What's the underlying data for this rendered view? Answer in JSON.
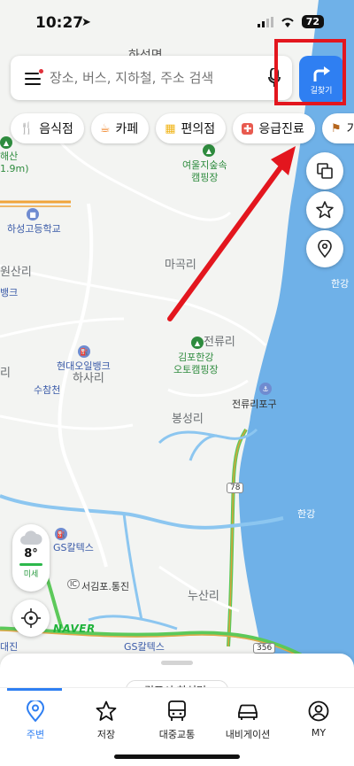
{
  "status_bar": {
    "time": "10:27",
    "battery": "72"
  },
  "search": {
    "placeholder": "장소, 버스, 지하철, 주소 검색"
  },
  "directions": {
    "label": "길찾기"
  },
  "categories": [
    {
      "label": "음식점",
      "icon": "fork-knife-icon"
    },
    {
      "label": "카페",
      "icon": "coffee-icon"
    },
    {
      "label": "편의점",
      "icon": "store-icon"
    },
    {
      "label": "응급진료",
      "icon": "medical-cross-icon"
    },
    {
      "label": "가",
      "icon": "flag-icon"
    }
  ],
  "map": {
    "top_town": "하성면",
    "labels": {
      "haesan": "해산",
      "haesan_dist": "1.9m)",
      "forest_camp": "여울지숲속\n캠핑장",
      "school": "하성고등학교",
      "wonsan": "원산리",
      "bank_left": "뱅크",
      "magok": "마곡리",
      "river_right_1": "한강",
      "jeonryu": "전류리",
      "hyundai_bank": "현대오일뱅크",
      "hasa": "하사리",
      "gimpo_camp": "김포한강\n오토캠핑장",
      "sucham": "수참천",
      "ri_left": "리",
      "bongseong": "봉성리",
      "jeonryu_port": "전류리포구",
      "road_78": "78",
      "river_right_2": "한강",
      "gs_caltex_1": "GS칼텍스",
      "seogimpo": "서김포.통진",
      "nusan": "누산리",
      "gs_caltex_2": "GS칼텍스",
      "daejin": "대진",
      "road_356": "356",
      "ic": "IC"
    }
  },
  "weather": {
    "temp": "8°",
    "dust": "미세"
  },
  "naver_logo": "NAVER",
  "sheet": {
    "chip_text": "김포시 하성면"
  },
  "tabs": [
    {
      "label": "주변",
      "icon": "location-pin-icon",
      "active": true
    },
    {
      "label": "저장",
      "icon": "star-icon",
      "active": false
    },
    {
      "label": "대중교통",
      "icon": "bus-icon",
      "active": false
    },
    {
      "label": "내비게이션",
      "icon": "car-icon",
      "active": false
    },
    {
      "label": "MY",
      "icon": "profile-icon",
      "active": false
    }
  ],
  "colors": {
    "accent": "#2f7ff2",
    "annotation_red": "#e3161e",
    "river": "#6fb1e8"
  }
}
